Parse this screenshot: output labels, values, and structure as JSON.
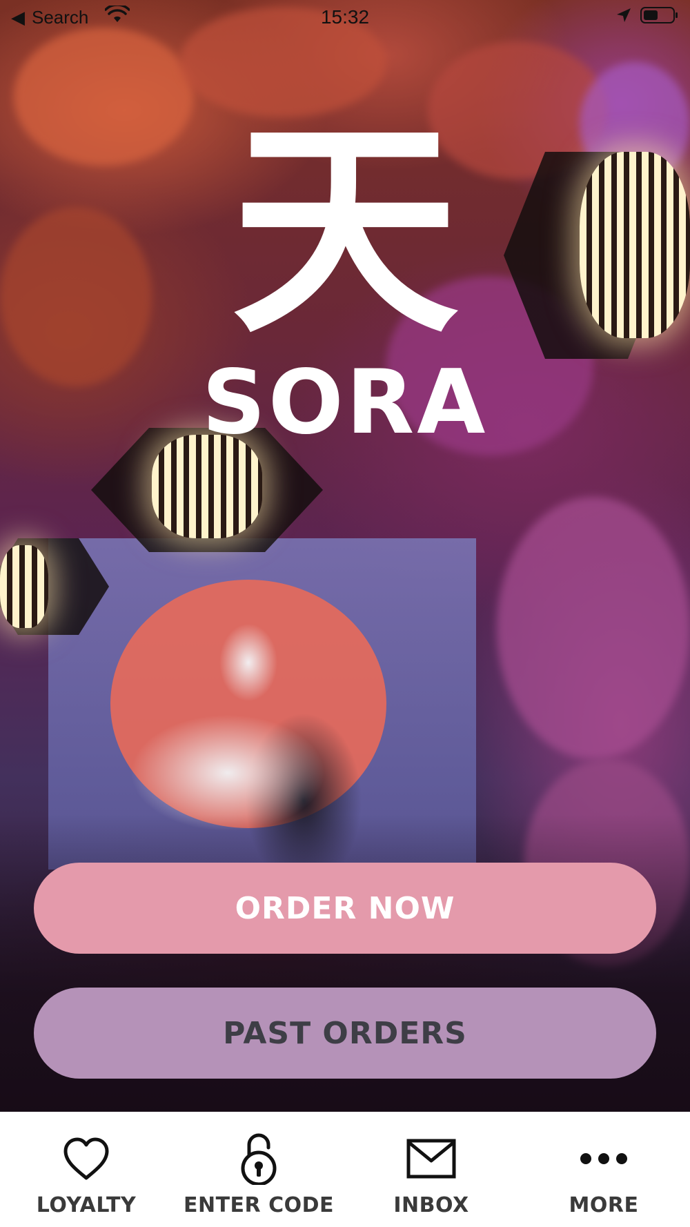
{
  "status_bar": {
    "back_glyph": "◀",
    "carrier": "Search",
    "time": "15:32"
  },
  "logo": {
    "kanji": "天",
    "word": "SORA"
  },
  "buttons": {
    "order_now": "ORDER NOW",
    "past_orders": "PAST ORDERS"
  },
  "colors": {
    "order_button": "#e49aab",
    "past_button": "#b592b8",
    "tab_bar_bg": "#ffffff",
    "tab_label": "#3a3a3a"
  },
  "tab_bar": {
    "items": [
      {
        "label": "LOYALTY",
        "icon": "heart-icon"
      },
      {
        "label": "ENTER CODE",
        "icon": "unlock-icon"
      },
      {
        "label": "INBOX",
        "icon": "envelope-icon"
      },
      {
        "label": "MORE",
        "icon": "more-dots-icon"
      }
    ]
  }
}
